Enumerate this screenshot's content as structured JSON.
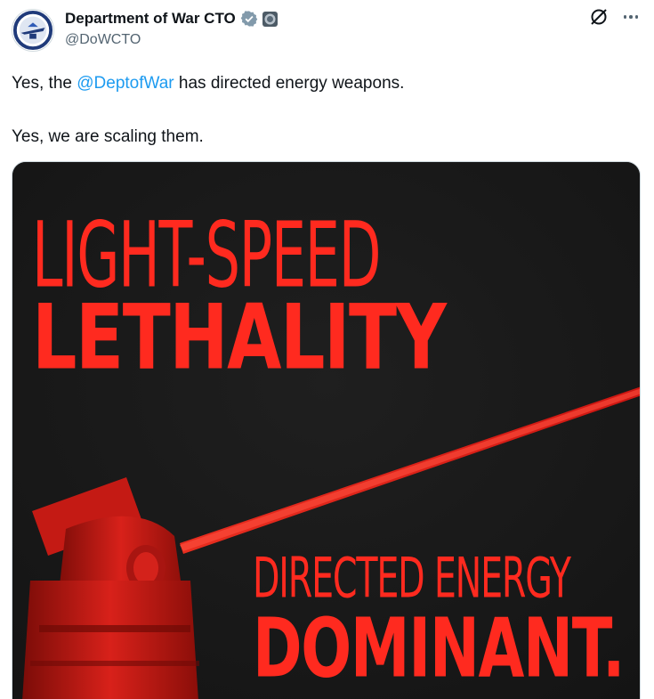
{
  "post": {
    "author_name": "Department of War CTO",
    "handle": "@DoWCTO",
    "text_prefix": "Yes, the ",
    "mention": "@DeptofWar",
    "text_suffix": " has directed energy weapons.",
    "line2": "Yes, we are scaling them."
  },
  "icons": {
    "verified": "verified-badge-icon",
    "affiliation": "affiliation-badge-icon",
    "grok": "grok-icon",
    "more": "more-options-icon"
  },
  "media": {
    "headline_1": "LIGHT-SPEED",
    "headline_2": "LETHALITY",
    "headline_3": "DIRECTED ENERGY",
    "headline_4": "DOMINANT."
  },
  "colors": {
    "accent_red": "#ff2a1f",
    "link_blue": "#1d9bf0",
    "verified_gray": "#829aab"
  }
}
